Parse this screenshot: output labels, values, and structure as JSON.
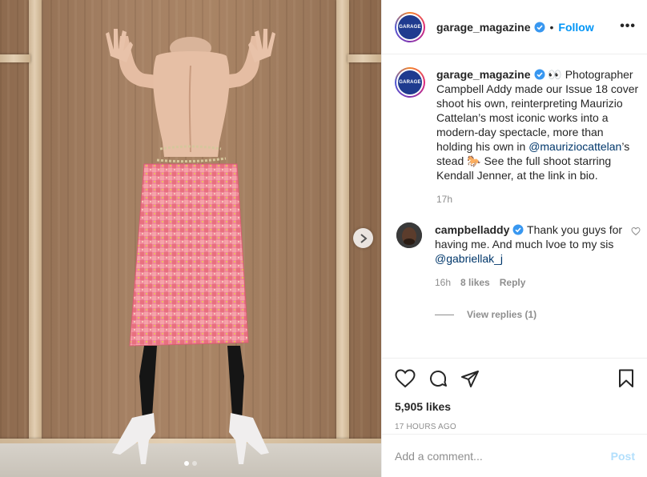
{
  "account": {
    "username": "garage_magazine",
    "avatar_text": "GARAGE"
  },
  "header": {
    "follow_label": "Follow",
    "separator": "•",
    "more_label": "•••"
  },
  "caption": {
    "username": "garage_magazine",
    "text_part1": " 👀 Photographer Campbell Addy made our Issue 18 cover shoot his own, reinterpreting Maurizio Cattelan’s most iconic works into a modern-day spectacle, more than holding his own in ",
    "mention": "@mauriziocattelan",
    "text_part2": "’s stead 🐎 See the full shoot starring Kendall Jenner, at the link in bio.",
    "time": "17h"
  },
  "comment": {
    "username": "campbelladdy",
    "text": " Thank you guys for having me. And much lvoe to my sis ",
    "mention": "@gabriellak_j",
    "time": "16h",
    "likes": "8 likes",
    "reply_label": "Reply",
    "view_replies": "View replies (1)"
  },
  "post": {
    "likes": "5,905 likes",
    "date": "17 HOURS AGO"
  },
  "add_comment": {
    "placeholder": "Add a comment...",
    "post_label": "Post"
  },
  "carousel": {
    "slide_count": 2,
    "active_index": 0
  },
  "colors": {
    "accent": "#0095f6",
    "verified": "#3897f0",
    "muted": "#8e8e8e",
    "mention": "#00376b"
  }
}
